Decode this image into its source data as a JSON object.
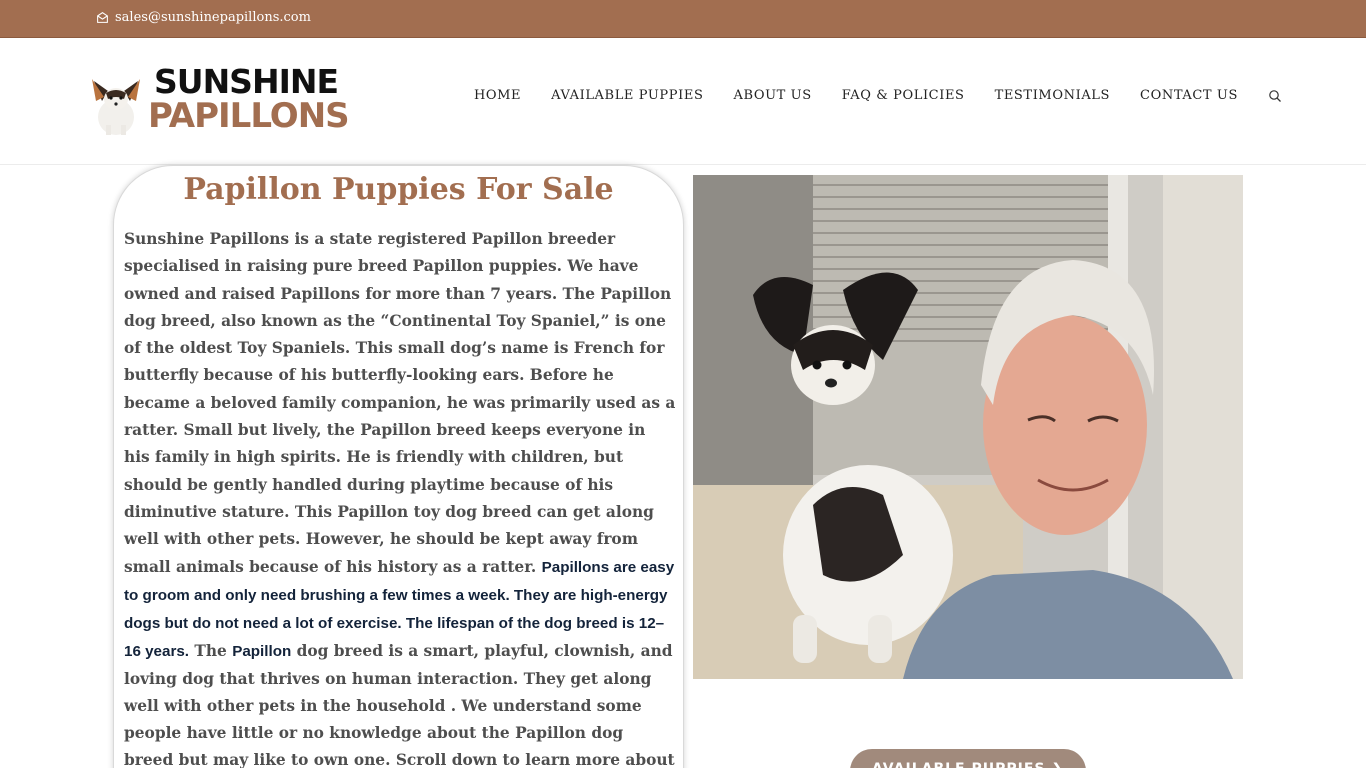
{
  "topbar": {
    "email": "sales@sunshinepapillons.com"
  },
  "logo": {
    "line1": "SUNSHINE",
    "line2": "PAPILLONS"
  },
  "nav": {
    "items": [
      "HOME",
      "AVAILABLE PUPPIES",
      "ABOUT US",
      "FAQ & POLICIES",
      "TESTIMONIALS",
      "CONTACT US"
    ]
  },
  "main": {
    "title": "Papillon Puppies For Sale",
    "p1": "Sunshine Papillons is a state registered Papillon breeder specialised in raising pure breed Papillon puppies. We have owned and raised Papillons for more than 7 years. The Papillon dog breed, also known as the “Continental Toy Spaniel,” is one of the oldest Toy Spaniels. This small dog’s name is French for butterfly because of his butterfly-looking ears. Before he became a beloved family companion, he was primarily used as a ratter. Small but lively, the Papillon breed keeps everyone in his family in high spirits. He is friendly with children, but should be gently handled during playtime because of his diminutive stature. This Papillon toy dog breed can get along well with other pets. However, he should be kept away from small animals because of his history as a ratter.",
    "p2": "Papillons are easy to groom and only need brushing a few times a week. They are high-energy dogs but do not need a lot of exercise. The lifespan of the dog breed is 12–16 years.",
    "p3a": "The",
    "p3b": "Papillon",
    "p3c": "dog breed is a smart, playful, clownish, and loving dog that thrives on human interaction. They get along well with other pets in the household . We understand some people have little or no knowledge about the Papillon dog breed but may like to own one. Scroll down to learn more about this perfect family dog breed."
  },
  "cta": {
    "label": "AVAILABLE PUPPIES ❯"
  },
  "colors": {
    "brand_brown": "#a26e50",
    "button": "#a18a7c",
    "dark_text": "#13233a"
  },
  "icons": [
    "envelope-icon",
    "search-icon"
  ]
}
